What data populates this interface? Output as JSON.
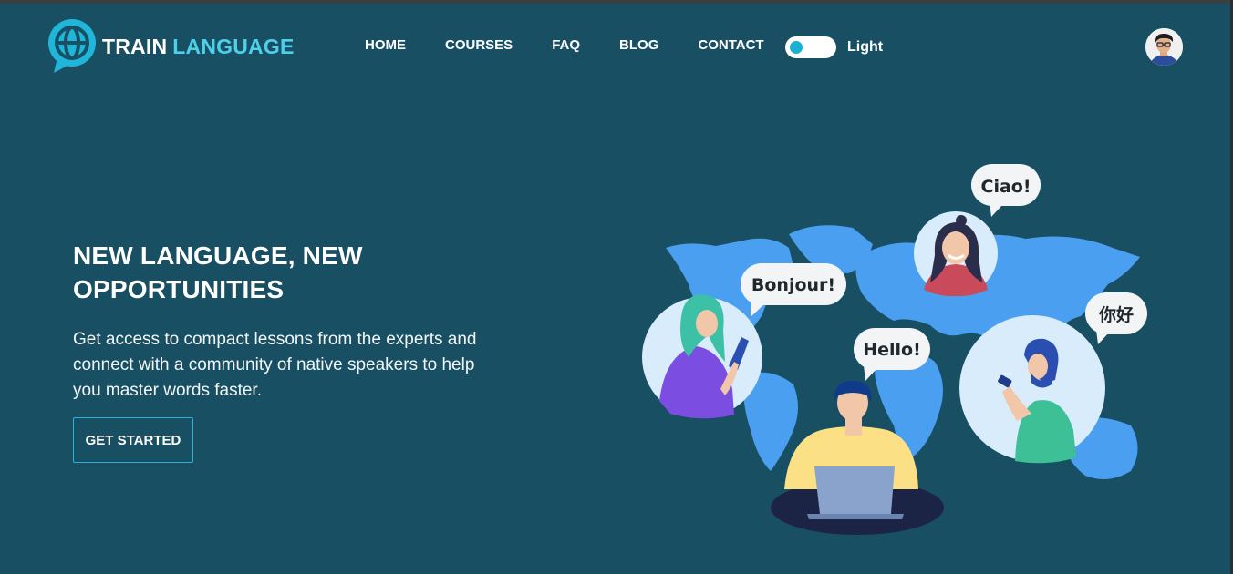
{
  "brand": {
    "word1": "TRAIN",
    "word2": "LANGUAGE",
    "logo_icon": "globe-chat-icon"
  },
  "nav": {
    "items": [
      "HOME",
      "COURSES",
      "FAQ",
      "BLOG",
      "CONTACT"
    ]
  },
  "theme_toggle": {
    "label": "Light",
    "state": "on"
  },
  "user": {
    "avatar_icon": "user-avatar"
  },
  "hero": {
    "title": "NEW LANGUAGE, NEW OPPORTUNITIES",
    "description": "Get access to compact lessons from the experts and connect with a community of native speakers to help you master words faster.",
    "cta_label": "GET STARTED"
  },
  "illustration": {
    "greetings": [
      "Ciao!",
      "Bonjour!",
      "你好",
      "Hello!"
    ]
  },
  "colors": {
    "background": "#184f63",
    "accent": "#4fd0ea",
    "toggle_knob": "#1ab0d3",
    "map": "#4a9ff0"
  }
}
